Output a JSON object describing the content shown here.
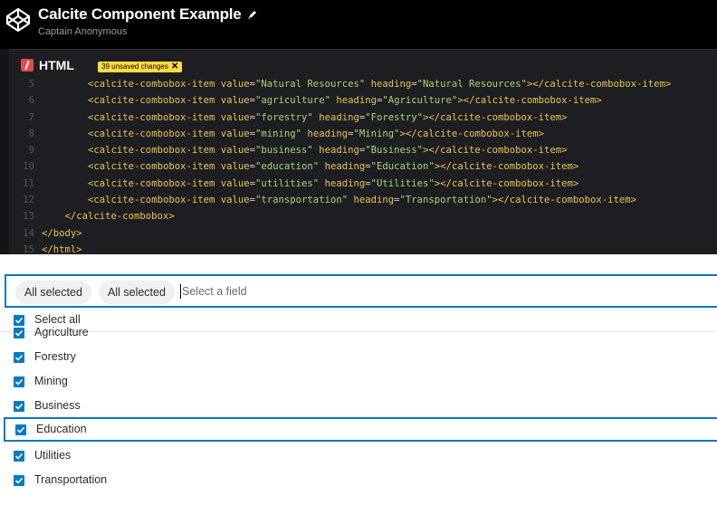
{
  "header": {
    "title": "Calcite Component Example",
    "author": "Captain Anonymous"
  },
  "editor": {
    "label": "HTML",
    "unsaved": "39 unsaved changes"
  },
  "code_lines": [
    {
      "n": "5",
      "indent": "        ",
      "tag": "calcite-combobox-item",
      "value": "\"Natural Resources\"",
      "heading": "\"Natural Resources\"",
      "close": "calcite-combobox-item"
    },
    {
      "n": "6",
      "indent": "        ",
      "tag": "calcite-combobox-item",
      "value": "\"agriculture\"",
      "heading": "\"Agriculture\"",
      "close": "calcite-combobox-item"
    },
    {
      "n": "7",
      "indent": "        ",
      "tag": "calcite-combobox-item",
      "value": "\"forestry\"",
      "heading": "\"Forestry\"",
      "close": "calcite-combobox-item"
    },
    {
      "n": "8",
      "indent": "        ",
      "tag": "calcite-combobox-item",
      "value": "\"mining\"",
      "heading": "\"Mining\"",
      "close": "calcite-combobox-item"
    },
    {
      "n": "9",
      "indent": "        ",
      "tag": "calcite-combobox-item",
      "value": "\"business\"",
      "heading": "\"Business\"",
      "close": "calcite-combobox-item"
    },
    {
      "n": "10",
      "indent": "        ",
      "tag": "calcite-combobox-item",
      "value": "\"education\"",
      "heading": "\"Education\"",
      "close": "calcite-combobox-item"
    },
    {
      "n": "11",
      "indent": "        ",
      "tag": "calcite-combobox-item",
      "value": "\"utilities\"",
      "heading": "\"Utilities\"",
      "close": "calcite-combobox-item"
    },
    {
      "n": "12",
      "indent": "        ",
      "tag": "calcite-combobox-item",
      "value": "\"transportation\"",
      "heading": "\"Transportation\"",
      "close": "calcite-combobox-item"
    }
  ],
  "code_tail": [
    {
      "n": "13",
      "text": "    </calcite-combobox>"
    },
    {
      "n": "14",
      "text": "</body>"
    },
    {
      "n": "15",
      "text": "</html>"
    }
  ],
  "combobox": {
    "chips": [
      "All selected",
      "All selected"
    ],
    "placeholder": "Select a field",
    "select_all": "Select all",
    "items": [
      "Agriculture",
      "Forestry",
      "Mining",
      "Business",
      "Education",
      "Utilities",
      "Transportation"
    ],
    "focused_item": "Education"
  },
  "colors": {
    "accent": "#007ac2",
    "editor_bg": "#1d1e22",
    "badge": "#ffdd40",
    "html_icon": "#e5484d"
  }
}
